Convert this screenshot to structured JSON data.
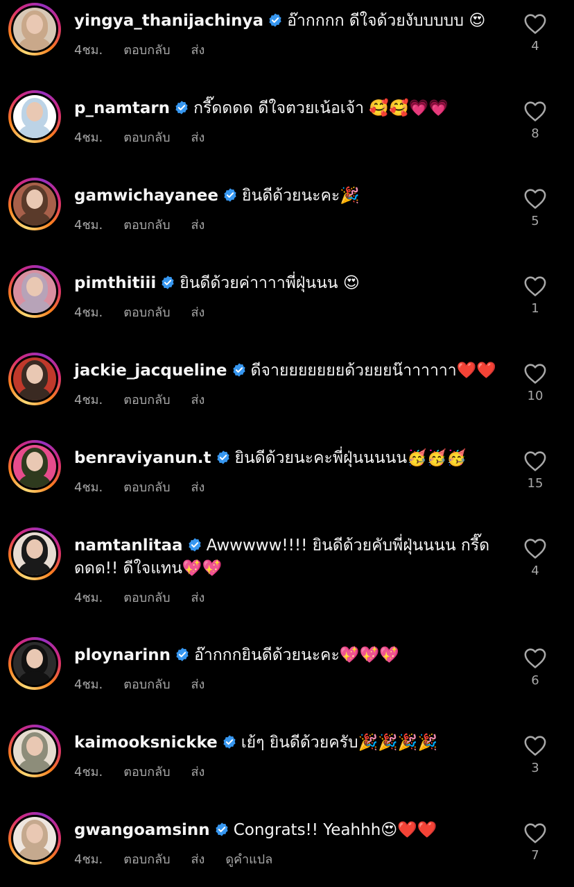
{
  "meta_labels": {
    "time": "4ชม.",
    "reply": "ตอบกลับ",
    "send": "ส่ง",
    "translate": "ดูคำแปล"
  },
  "colors": {
    "background": "#000000",
    "verified": "#3797f0",
    "meta_text": "#a8a8a8"
  },
  "comments": [
    {
      "username": "yingya_thanijachinya",
      "text": "อ๊ากกกก ดีใจด้วยงับบบบบ 😍",
      "time": "4ชม.",
      "likes": "4",
      "avatar_colors": [
        "#c9a88a",
        "#d8c8b6"
      ]
    },
    {
      "username": "p_namtarn",
      "text": "กรี๊ดดดด ดีใจตวยเน้อเจ้า 🥰🥰💗💗",
      "time": "4ชม.",
      "likes": "8",
      "avatar_colors": [
        "#bcd3e6",
        "#ffffff"
      ]
    },
    {
      "username": "gamwichayanee",
      "text": "ยินดีด้วยนะคะ🎉",
      "time": "4ชม.",
      "likes": "5",
      "avatar_colors": [
        "#5a3a2a",
        "#a8604a"
      ]
    },
    {
      "username": "pimthitiii",
      "text": "ยินดีด้วยค่าาาาพี่ฝุ่นนน 😍",
      "time": "4ชม.",
      "likes": "1",
      "avatar_colors": [
        "#b7a3b8",
        "#d98fa0"
      ]
    },
    {
      "username": "jackie_jacqueline",
      "text": "ดีจายยยยยยยด้วยยยน๊าาาาาา❤️❤️",
      "time": "4ชม.",
      "likes": "10",
      "avatar_colors": [
        "#3a2a22",
        "#c0392b"
      ]
    },
    {
      "username": "benraviyanun.t",
      "text": "ยินดีด้วยนะคะพี่ฝุ่นนนนน🥳🥳🥳",
      "time": "4ชม.",
      "likes": "15",
      "avatar_colors": [
        "#2e3a1e",
        "#e74c8c"
      ]
    },
    {
      "username": "namtanlitaa",
      "text": "Awwwww!!!! ยินดีด้วยคับพี่ฝุ่นนนน กรี๊ดดดด!! ดีใจแทน💖💖",
      "time": "4ชม.",
      "likes": "4",
      "avatar_colors": [
        "#1a1a1a",
        "#e8dcd2"
      ]
    },
    {
      "username": "ploynarinn",
      "text": "อ๊ากกกยินดีด้วยนะคะ💖💖💖",
      "time": "4ชม.",
      "likes": "6",
      "avatar_colors": [
        "#111111",
        "#2c2c2c"
      ]
    },
    {
      "username": "kaimooksnickke",
      "text": "เย้ๆ ยินดีด้วยครับ🎉🎉🎉🎉",
      "time": "4ชม.",
      "likes": "3",
      "avatar_colors": [
        "#8d8d7a",
        "#e6ddd0"
      ]
    },
    {
      "username": "gwangoamsinn",
      "text": "Congrats!! Yeahhh😍❤️❤️",
      "time": "4ชม.",
      "likes": "7",
      "avatar_colors": [
        "#c5a98e",
        "#eee6df"
      ],
      "show_translate": true
    }
  ]
}
